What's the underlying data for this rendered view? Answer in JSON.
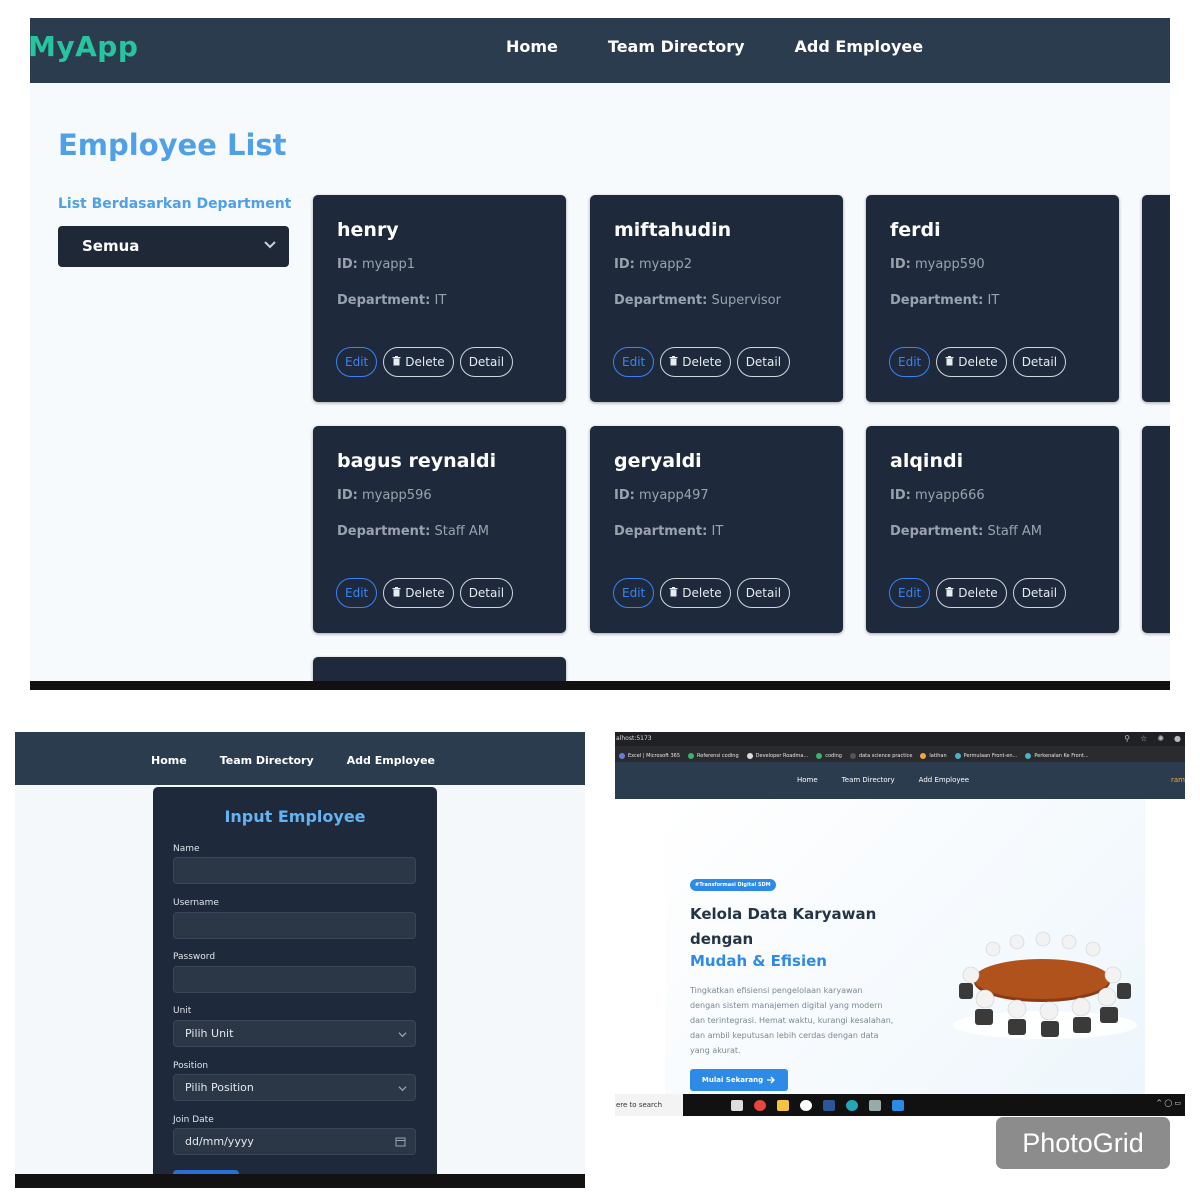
{
  "list_page": {
    "logo": "MyApp",
    "nav": [
      "Home",
      "Team Directory",
      "Add Employee"
    ],
    "title": "Employee List",
    "filter_label": "List Berdasarkan Department",
    "filter_value": "Semua",
    "id_label": "ID:",
    "department_label": "Department:",
    "buttons": {
      "edit": "Edit",
      "delete": "Delete",
      "detail": "Detail"
    },
    "employees": [
      {
        "name": "henry",
        "id": "myapp1",
        "department": "IT"
      },
      {
        "name": "miftahudin",
        "id": "myapp2",
        "department": "Supervisor"
      },
      {
        "name": "ferdi",
        "id": "myapp590",
        "department": "IT"
      },
      {
        "name": "bagus reynaldi",
        "id": "myapp596",
        "department": "Staff AM"
      },
      {
        "name": "geryaldi",
        "id": "myapp497",
        "department": "IT"
      },
      {
        "name": "alqindi",
        "id": "myapp666",
        "department": "Staff AM"
      }
    ]
  },
  "form_page": {
    "nav": [
      "Home",
      "Team Directory",
      "Add Employee"
    ],
    "title": "Input Employee",
    "fields": [
      {
        "label": "Name",
        "value": ""
      },
      {
        "label": "Username",
        "value": ""
      },
      {
        "label": "Password",
        "value": ""
      },
      {
        "label": "Unit",
        "value": "Pilih Unit"
      },
      {
        "label": "Position",
        "value": "Pilih Position"
      },
      {
        "label": "Join Date",
        "value": "dd/mm/yyyy"
      }
    ]
  },
  "landing_page": {
    "url": "alhost:5173",
    "bookmarks": [
      "Excel | Microsoft 365",
      "Referensi coding",
      "Developer Roadma...",
      "coding",
      "data science practice",
      "latihan",
      "Permulaan Front-en...",
      "Perkenalan Ke Front..."
    ],
    "nav": [
      "Home",
      "Team Directory",
      "Add Employee"
    ],
    "user": "ram",
    "badge": "#Transformasi Digital SDM",
    "headline": "Kelola Data Karyawan dengan",
    "headline_accent": "Mudah & Efisien",
    "description": "Tingkatkan efisiensi pengelolaan karyawan dengan sistem manajemen digital yang modern dan terintegrasi. Hemat waktu, kurangi kesalahan, dan ambil keputusan lebih cerdas dengan data yang akurat.",
    "cta": "Mulai Sekarang",
    "taskbar_search": "ere to search"
  },
  "watermark": "PhotoGrid",
  "colors": {
    "nav": "#2b3c4e",
    "card": "#1e2a3b",
    "accent": "#4fa0e6",
    "logo": "#27c4a0",
    "edit": "#3b82f6"
  }
}
